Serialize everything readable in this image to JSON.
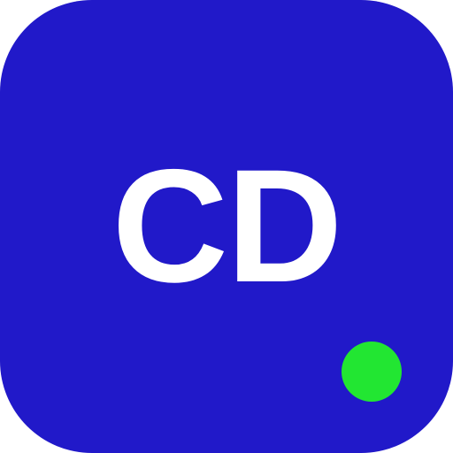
{
  "avatar": {
    "initials": "CD",
    "background_color": "#2119c9",
    "text_color": "#ffffff"
  },
  "status": {
    "indicator": "online-dot",
    "color": "#22e632"
  }
}
